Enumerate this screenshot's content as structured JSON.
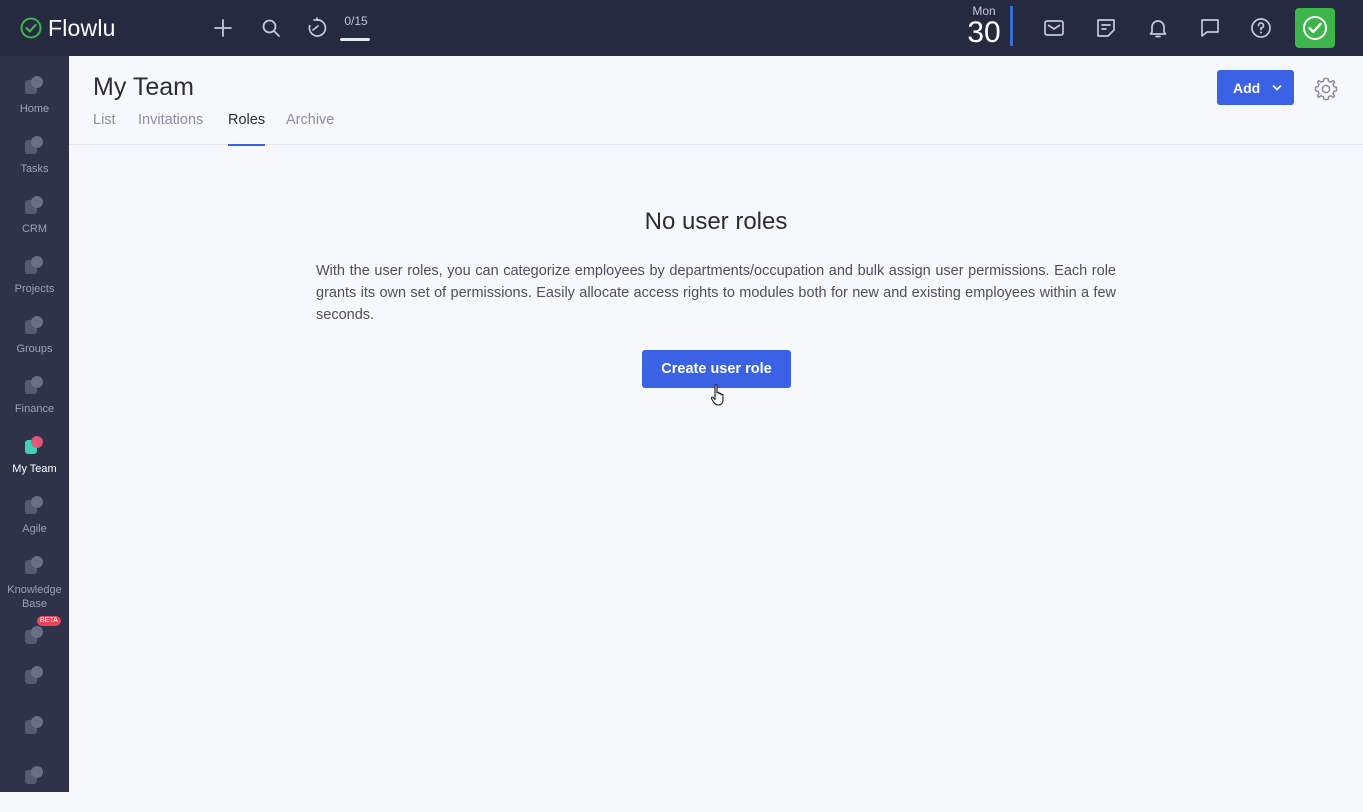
{
  "app": {
    "name": "Flowlu",
    "brand_color": "#3cb54a",
    "accent_color": "#3b62e5"
  },
  "topbar": {
    "counter": {
      "text": "0/15",
      "fraction": 0.0
    },
    "date": {
      "day": "Mon",
      "number": "30"
    },
    "icons": [
      "plus-icon",
      "search-icon",
      "timer-icon",
      "mail-icon",
      "notes-icon",
      "bell-icon",
      "chat-icon",
      "help-icon",
      "avatar"
    ]
  },
  "sidebar": {
    "items": [
      {
        "label": "Home",
        "icon": "home-icon"
      },
      {
        "label": "Tasks",
        "icon": "tasks-icon"
      },
      {
        "label": "CRM",
        "icon": "crm-icon"
      },
      {
        "label": "Projects",
        "icon": "projects-icon"
      },
      {
        "label": "Groups",
        "icon": "groups-icon"
      },
      {
        "label": "Finance",
        "icon": "finance-icon"
      },
      {
        "label": "My Team",
        "icon": "team-icon",
        "active": true
      },
      {
        "label": "Agile",
        "icon": "agile-icon"
      },
      {
        "label": "Knowledge Base",
        "icon": "knowledge-base-icon"
      },
      {
        "label": "",
        "icon": "beta-module-icon",
        "badge": "BETA"
      },
      {
        "label": "",
        "icon": "portal-icon"
      },
      {
        "label": "",
        "icon": "settings-icon"
      },
      {
        "label": "",
        "icon": "feedback-icon"
      }
    ]
  },
  "header": {
    "title": "My Team",
    "tabs": [
      {
        "label": "List"
      },
      {
        "label": "Invitations"
      },
      {
        "label": "Roles",
        "active": true
      },
      {
        "label": "Archive"
      }
    ],
    "add_label": "Add"
  },
  "empty_state": {
    "title": "No user roles",
    "text": "With the user roles, you can categorize employees by departments/occupation and bulk assign user permissions. Each role grants its own set of permissions. Easily allocate access rights to modules both for new and existing employees within a few seconds.",
    "button_label": "Create user role"
  }
}
